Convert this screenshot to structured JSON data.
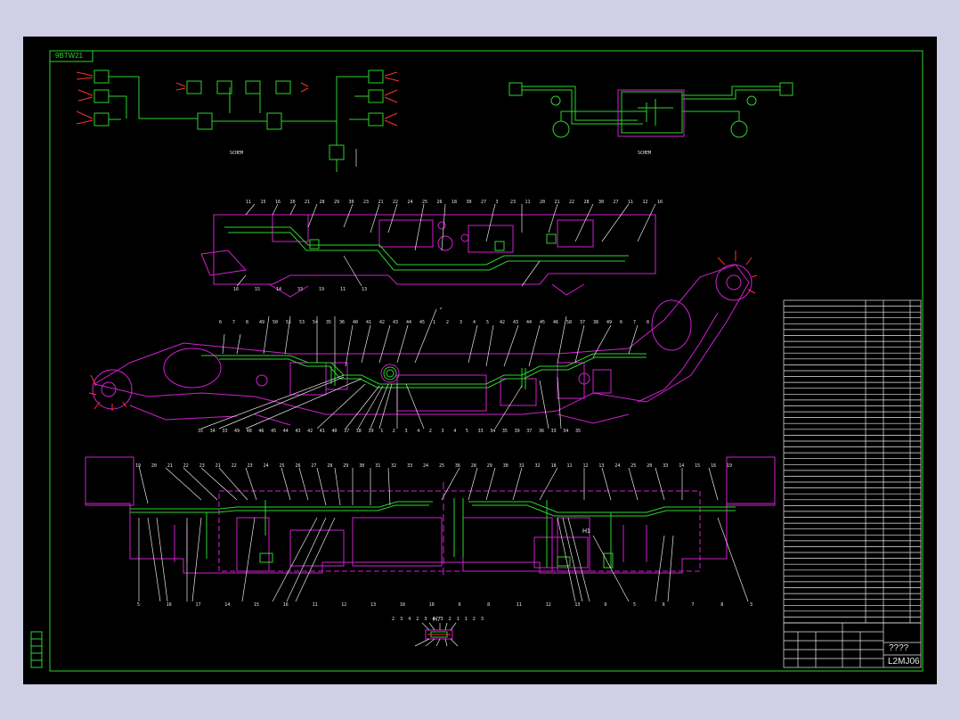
{
  "drawing": {
    "frame_code": "9BTW21",
    "title_name": "????",
    "drawing_number": "L2MJ06",
    "detail_label": "H7",
    "section_label": "H1"
  },
  "colors": {
    "background": "#cfd0e6",
    "canvas": "#000000",
    "frame": "#2bd42b",
    "wiring": "#2bd42b",
    "outline": "#d020d0",
    "leader": "#e8e8e8",
    "accent": "#ff3030"
  },
  "callouts": {
    "view1_top": [
      "11",
      "15",
      "16",
      "20",
      "21",
      "28",
      "29",
      "30",
      "23",
      "21",
      "22",
      "24",
      "25",
      "26",
      "18",
      "30",
      "27",
      "3",
      "23",
      "11",
      "20",
      "21",
      "22",
      "28",
      "30",
      "27",
      "11",
      "12",
      "16"
    ],
    "view1_bottom": [
      "16",
      "15",
      "14",
      "33",
      "19",
      "11",
      "13"
    ],
    "view2_top": [
      "6",
      "7",
      "8",
      "49",
      "50",
      "51",
      "53",
      "54",
      "35",
      "36",
      "40",
      "41",
      "42",
      "43",
      "44",
      "45",
      "1",
      "2",
      "3",
      "4",
      "5",
      "42",
      "43",
      "44",
      "45",
      "46",
      "58",
      "37",
      "38",
      "49",
      "6",
      "7",
      "8"
    ],
    "view2_bottom": [
      "35",
      "34",
      "33",
      "49",
      "48",
      "46",
      "45",
      "44",
      "43",
      "42",
      "41",
      "40",
      "37",
      "38",
      "39",
      "1",
      "2",
      "3",
      "4",
      "2",
      "3",
      "4",
      "5",
      "33",
      "34",
      "35",
      "39",
      "37",
      "36",
      "33",
      "34",
      "35"
    ],
    "view3_top": [
      "19",
      "20",
      "21",
      "22",
      "23",
      "21",
      "22",
      "23",
      "24",
      "25",
      "26",
      "27",
      "28",
      "29",
      "30",
      "31",
      "32",
      "33",
      "24",
      "25",
      "36",
      "28",
      "29",
      "30",
      "31",
      "32",
      "18",
      "11",
      "12",
      "13",
      "24",
      "25",
      "20",
      "33",
      "14",
      "15",
      "16",
      "19"
    ],
    "view3_bottom": [
      "5",
      "16",
      "17",
      "14",
      "15",
      "16",
      "11",
      "12",
      "13",
      "18",
      "10",
      "9",
      "8",
      "11",
      "12",
      "13",
      "9",
      "5",
      "6",
      "7",
      "8",
      "3"
    ],
    "detail": [
      "2",
      "3",
      "4",
      "2",
      "3",
      "4",
      "3",
      "2",
      "1",
      "1",
      "2",
      "3"
    ]
  },
  "bom_rows": 55
}
